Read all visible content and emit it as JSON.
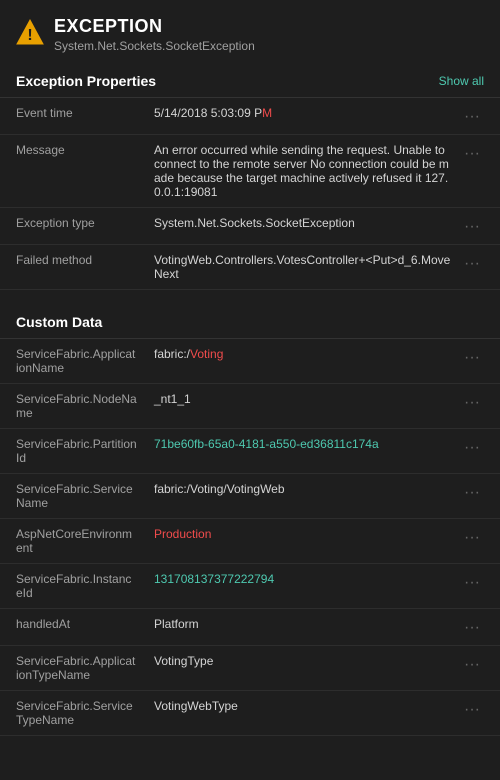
{
  "header": {
    "icon_label": "warning-triangle-icon",
    "title": "EXCEPTION",
    "subtitle": "System.Net.Sockets.SocketException"
  },
  "exception_properties": {
    "section_title": "Exception Properties",
    "show_all_label": "Show all",
    "rows": [
      {
        "label": "Event time",
        "value": "5/14/2018 5:03:09 P",
        "value_highlight": "M",
        "has_highlight": true
      },
      {
        "label": "Message",
        "value": "An error occurred while sending the request. Unable to connect to the remote server No connection could be made because the target machine actively refused it 127.0.0.1:19081",
        "value_highlight": "",
        "has_highlight": false
      },
      {
        "label": "Exception type",
        "value": "System.Net.Sockets.SocketException",
        "has_highlight": false
      },
      {
        "label": "Failed method",
        "value": "VotingWeb.Controllers.VotesController+<Put>d_6.MoveNext",
        "value_highlight": "",
        "has_highlight": false
      }
    ]
  },
  "custom_data": {
    "section_title": "Custom Data",
    "rows": [
      {
        "label": "ServiceFabric.ApplicationName",
        "value": "fabric:/Voting",
        "value_plain": "fabric:/",
        "value_highlight": "Voting",
        "has_highlight": true
      },
      {
        "label": "ServiceFabric.NodeName",
        "value": "_nt1_1",
        "has_highlight": false
      },
      {
        "label": "ServiceFabric.PartitionId",
        "value": "71be60fb-65a0-4181-a550-ed36811c174a",
        "has_highlight": false,
        "is_link": true
      },
      {
        "label": "ServiceFabric.ServiceName",
        "value": "fabric:/Voting/VotingWeb",
        "has_highlight": false
      },
      {
        "label": "AspNetCoreEnvironment",
        "value": "Production",
        "value_plain": "",
        "value_highlight": "Production",
        "has_highlight": true
      },
      {
        "label": "ServiceFabric.InstanceId",
        "value": "131708137377222794",
        "has_highlight": false,
        "is_link": true
      },
      {
        "label": "handledAt",
        "value": "Platform",
        "has_highlight": false
      },
      {
        "label": "ServiceFabric.ApplicationTypeName",
        "value": "VotingType",
        "has_highlight": false
      },
      {
        "label": "ServiceFabric.ServiceTypeName",
        "value": "VotingWebType",
        "has_highlight": false
      }
    ]
  },
  "dots_label": "···"
}
